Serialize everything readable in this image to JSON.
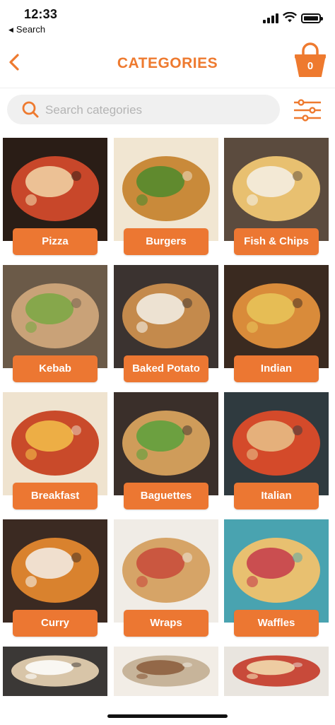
{
  "status_bar": {
    "time": "12:33",
    "back_app": "Search"
  },
  "header": {
    "title": "CATEGORIES",
    "basket_count": "0"
  },
  "search": {
    "placeholder": "Search categories"
  },
  "colors": {
    "accent": "#ee7a2f",
    "label_bg": "#ec7732",
    "search_bg": "#f0f0f0"
  },
  "icons": [
    "back-chevron-icon",
    "basket-icon",
    "search-icon",
    "filter-sliders-icon"
  ],
  "categories": [
    {
      "label": "Pizza"
    },
    {
      "label": "Burgers"
    },
    {
      "label": "Fish & Chips"
    },
    {
      "label": "Kebab"
    },
    {
      "label": "Baked Potato"
    },
    {
      "label": "Indian"
    },
    {
      "label": "Breakfast"
    },
    {
      "label": "Baguettes"
    },
    {
      "label": "Italian"
    },
    {
      "label": "Curry"
    },
    {
      "label": "Wraps"
    },
    {
      "label": "Waffles"
    },
    {
      "label": ""
    },
    {
      "label": ""
    },
    {
      "label": ""
    }
  ]
}
